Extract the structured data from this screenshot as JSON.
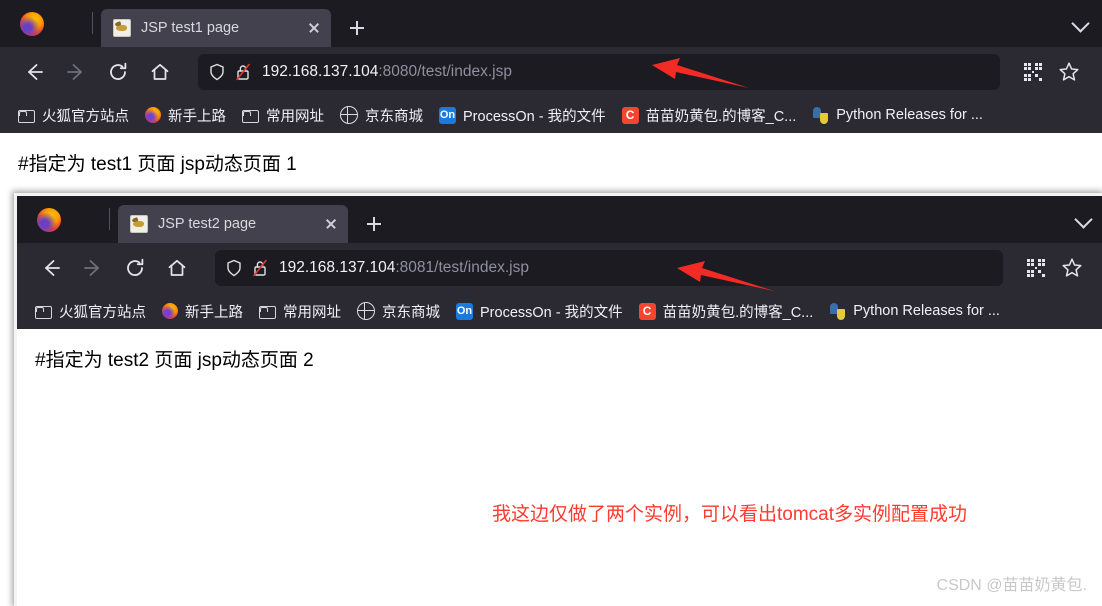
{
  "windows": [
    {
      "id": "window-1",
      "tab": {
        "title": "JSP test1 page",
        "favicon": "tomcat-cat-icon",
        "close_icon": "close-icon",
        "newtab_icon": "plus-icon",
        "list_tabs_icon": "chevron-down-icon"
      },
      "nav": {
        "back_icon": "back-arrow-icon",
        "forward_icon": "forward-arrow-icon",
        "reload_icon": "reload-icon",
        "home_icon": "home-icon",
        "shield_icon": "shield-icon",
        "lock_icon": "broken-lock-icon",
        "url_host": "192.168.137.104",
        "url_rest": ":8080/test/index.jsp",
        "url_full": "192.168.137.104:8080/test/index.jsp",
        "qr_icon": "qr-code-icon",
        "bookmark_icon": "star-icon"
      },
      "page_text": "#指定为 test1 页面 jsp动态页面 1"
    },
    {
      "id": "window-2",
      "tab": {
        "title": "JSP test2 page",
        "favicon": "tomcat-cat-icon",
        "close_icon": "close-icon",
        "newtab_icon": "plus-icon",
        "list_tabs_icon": "chevron-down-icon"
      },
      "nav": {
        "back_icon": "back-arrow-icon",
        "forward_icon": "forward-arrow-icon",
        "reload_icon": "reload-icon",
        "home_icon": "home-icon",
        "shield_icon": "shield-icon",
        "lock_icon": "broken-lock-icon",
        "url_host": "192.168.137.104",
        "url_rest": ":8081/test/index.jsp",
        "url_full": "192.168.137.104:8081/test/index.jsp",
        "qr_icon": "qr-code-icon",
        "bookmark_icon": "star-icon"
      },
      "page_text": "#指定为 test2 页面 jsp动态页面 2"
    }
  ],
  "bookmarks": [
    {
      "label": "火狐官方站点",
      "icon": "folder-icon"
    },
    {
      "label": "新手上路",
      "icon": "firefox-icon"
    },
    {
      "label": "常用网址",
      "icon": "folder-icon"
    },
    {
      "label": "京东商城",
      "icon": "globe-icon"
    },
    {
      "label": "ProcessOn - 我的文件",
      "icon": "processon-icon"
    },
    {
      "label": "苗苗奶黄包.的博客_C...",
      "icon": "csdn-icon"
    },
    {
      "label": "Python Releases for ...",
      "icon": "python-icon"
    }
  ],
  "annotations": {
    "red_note": "我这边仅做了两个实例，可以看出tomcat多实例配置成功",
    "arrow_1": "red-arrow-pointing-at-url-1",
    "arrow_2": "red-arrow-pointing-at-url-2"
  },
  "watermark": "CSDN @苗苗奶黄包.",
  "colors": {
    "chrome_tabstrip": "#1c1b22",
    "chrome_toolbar": "#2b2a33",
    "tab_active": "#42414d",
    "urlbar_bg": "#1c1b22",
    "url_host_text": "#f2f2f5",
    "url_rest_text": "#8f8f9d",
    "annotation_red": "#ff3b30",
    "page_bg": "#ffffff",
    "watermark_gray": "#c9c9c9"
  }
}
